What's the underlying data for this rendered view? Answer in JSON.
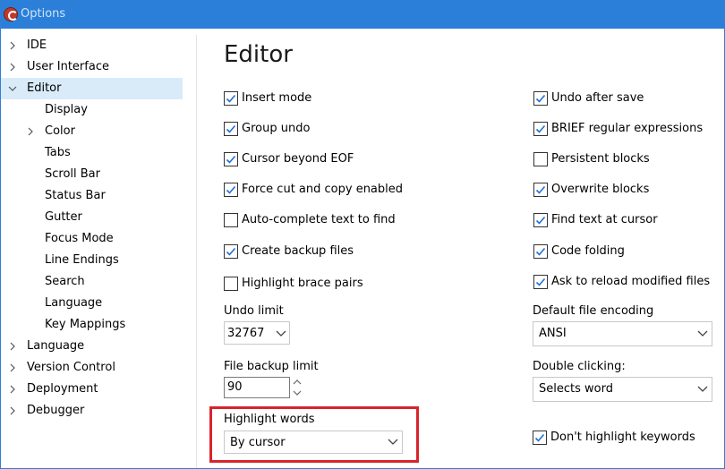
{
  "window": {
    "title": "Options"
  },
  "tree": {
    "items": [
      {
        "label": "IDE",
        "level": 0,
        "expander": "collapsed"
      },
      {
        "label": "User Interface",
        "level": 0,
        "expander": "collapsed"
      },
      {
        "label": "Editor",
        "level": 0,
        "expander": "expanded",
        "selected": true
      },
      {
        "label": "Display",
        "level": 1,
        "expander": "none"
      },
      {
        "label": "Color",
        "level": 1,
        "expander": "collapsed"
      },
      {
        "label": "Tabs",
        "level": 1,
        "expander": "none"
      },
      {
        "label": "Scroll Bar",
        "level": 1,
        "expander": "none"
      },
      {
        "label": "Status Bar",
        "level": 1,
        "expander": "none"
      },
      {
        "label": "Gutter",
        "level": 1,
        "expander": "none"
      },
      {
        "label": "Focus Mode",
        "level": 1,
        "expander": "none"
      },
      {
        "label": "Line Endings",
        "level": 1,
        "expander": "none"
      },
      {
        "label": "Search",
        "level": 1,
        "expander": "none"
      },
      {
        "label": "Language",
        "level": 1,
        "expander": "none"
      },
      {
        "label": "Key Mappings",
        "level": 1,
        "expander": "none"
      },
      {
        "label": "Language",
        "level": 0,
        "expander": "collapsed"
      },
      {
        "label": "Version Control",
        "level": 0,
        "expander": "collapsed"
      },
      {
        "label": "Deployment",
        "level": 0,
        "expander": "collapsed"
      },
      {
        "label": "Debugger",
        "level": 0,
        "expander": "collapsed"
      }
    ]
  },
  "editor": {
    "heading": "Editor",
    "left_options": [
      {
        "label": "Insert mode",
        "checked": true
      },
      {
        "label": "Group undo",
        "checked": true
      },
      {
        "label": "Cursor beyond EOF",
        "checked": true
      },
      {
        "label": "Force cut and copy enabled",
        "checked": true
      },
      {
        "label": "Auto-complete text to find",
        "checked": false
      },
      {
        "label": "Create backup files",
        "checked": true
      },
      {
        "label": "Highlight brace pairs",
        "checked": false
      }
    ],
    "right_options": [
      {
        "label": "Undo after save",
        "checked": true
      },
      {
        "label": "BRIEF regular expressions",
        "checked": true
      },
      {
        "label": "Persistent blocks",
        "checked": false
      },
      {
        "label": "Overwrite blocks",
        "checked": true
      },
      {
        "label": "Find text at cursor",
        "checked": true
      },
      {
        "label": "Code folding",
        "checked": true
      },
      {
        "label": "Ask to reload modified files",
        "checked": true
      }
    ],
    "undo_limit": {
      "label": "Undo limit",
      "value": "32767"
    },
    "file_backup_limit": {
      "label": "File backup limit",
      "value": "90"
    },
    "highlight_words": {
      "label": "Highlight words",
      "value": "By cursor"
    },
    "default_file_encoding": {
      "label": "Default file encoding",
      "value": "ANSI"
    },
    "double_clicking": {
      "label": "Double clicking:",
      "value": "Selects word"
    },
    "dont_highlight_keywords": {
      "label": "Don't highlight keywords",
      "checked": true
    }
  },
  "colors": {
    "accent": "#2b7fd8",
    "selection": "#d9ebf9",
    "annotation": "#d9232b",
    "check": "#1e6fd9"
  }
}
